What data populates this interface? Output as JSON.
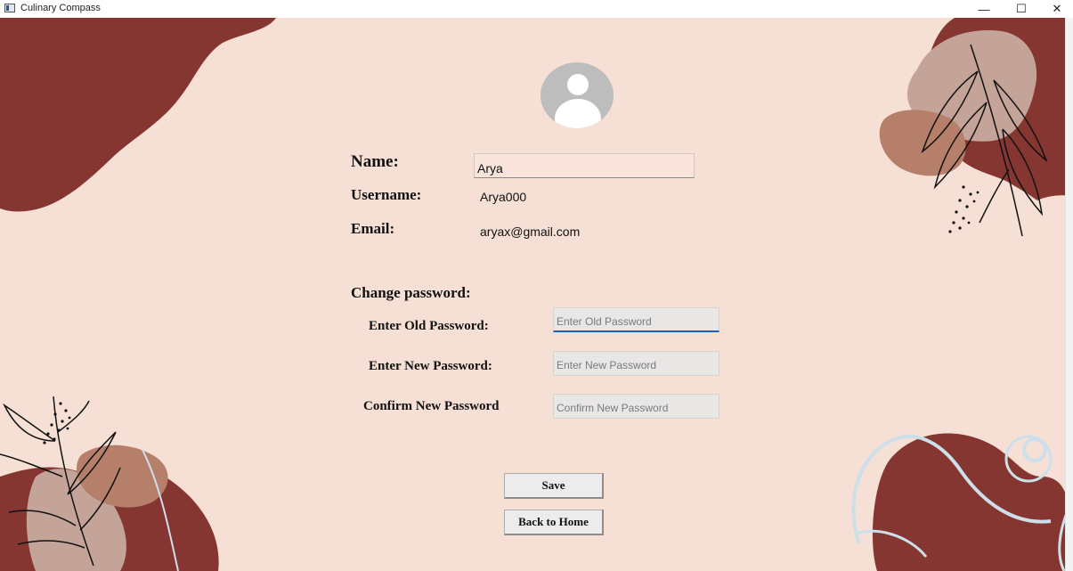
{
  "window": {
    "title": "Culinary Compass",
    "minimize_glyph": "—",
    "maximize_glyph": "☐",
    "close_glyph": "✕"
  },
  "profile": {
    "avatar_icon": "user-avatar-icon",
    "name_label": "Name:",
    "name_value": "Arya",
    "username_label": "Username:",
    "username_value": "Arya000",
    "email_label": "Email:",
    "email_value": "aryax@gmail.com"
  },
  "password": {
    "section_title": "Change password:",
    "old_label": "Enter Old Password:",
    "old_placeholder": "Enter Old Password",
    "new_label": "Enter New Password:",
    "new_placeholder": "Enter New Password",
    "confirm_label": "Confirm New Password",
    "confirm_placeholder": "Confirm New Password"
  },
  "actions": {
    "save_label": "Save",
    "home_label": "Back to Home"
  },
  "colors": {
    "background": "#f6dfd4",
    "maroon": "#853631",
    "clay": "#b57f6a",
    "taupe": "#c4a398",
    "light_blue": "#cde0ea"
  }
}
